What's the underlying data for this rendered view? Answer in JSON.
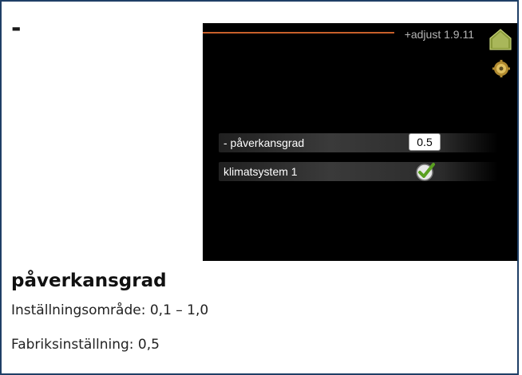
{
  "page": {
    "marker": "-"
  },
  "screen": {
    "header_title": "+adjust 1.9.11",
    "menu_rows": [
      {
        "label": "- påverkansgrad",
        "value": "0.5"
      },
      {
        "label": "klimatsystem 1",
        "checked": true
      }
    ],
    "colors": {
      "background": "#000000",
      "progress_line": "#c8602a",
      "check_green": "#5aa020"
    }
  },
  "description": {
    "heading": "påverkansgrad",
    "range_text": "Inställningsområde: 0,1 – 1,0",
    "default_text": "Fabriksinställning: 0,5"
  }
}
